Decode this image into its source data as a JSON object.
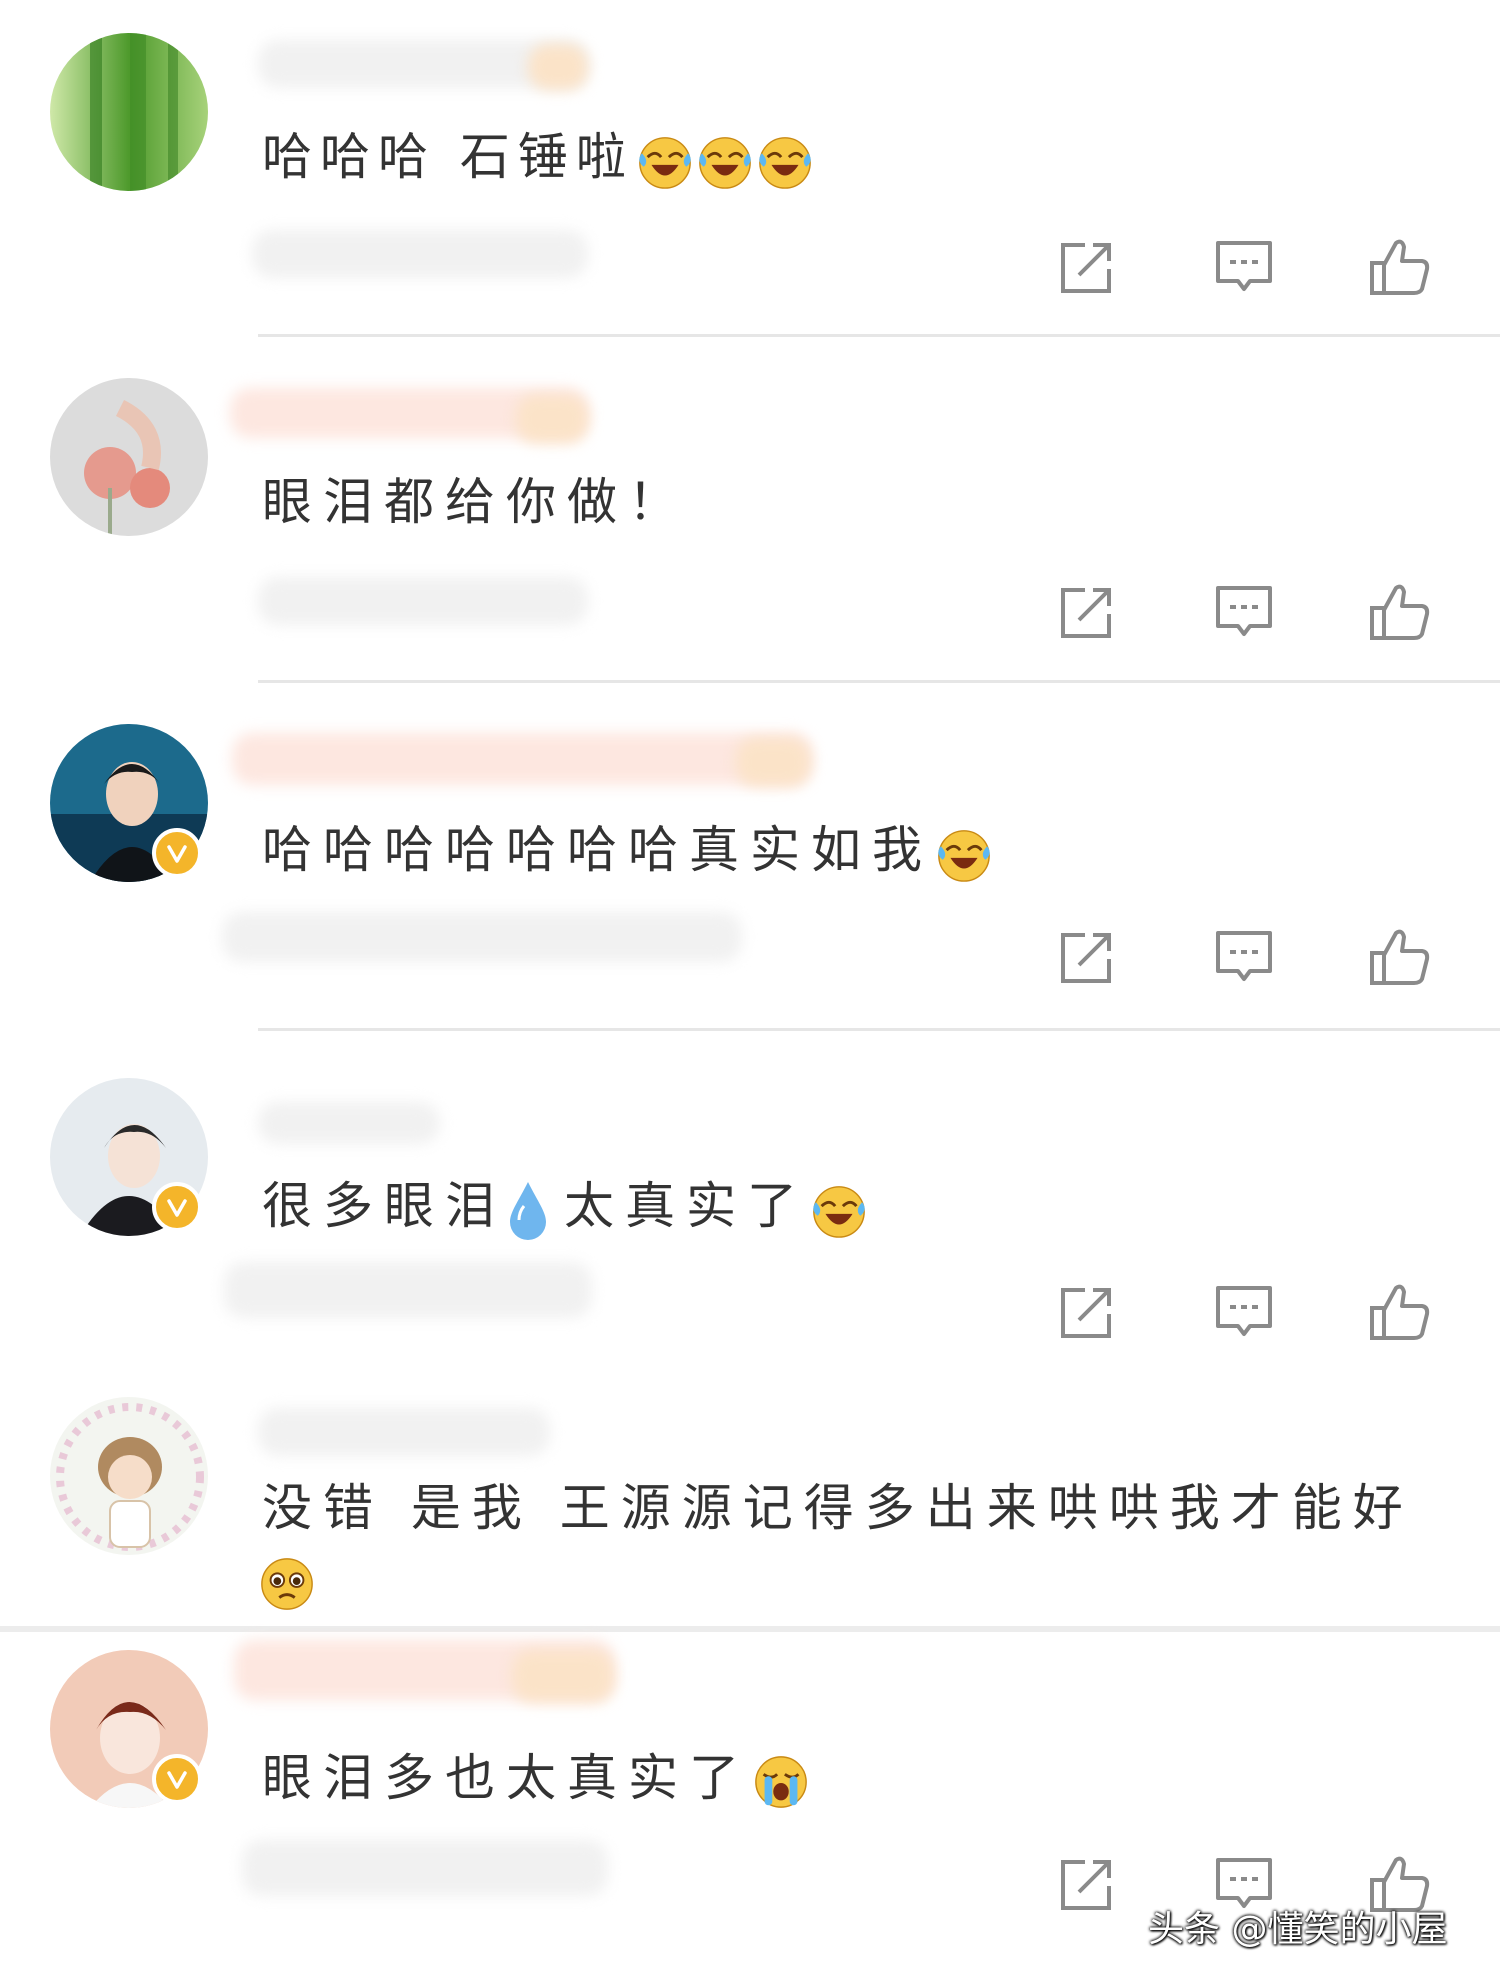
{
  "comments": [
    {
      "text": "哈哈哈  石锤啦",
      "emojis": [
        "laugh-cry",
        "laugh-cry",
        "laugh-cry"
      ],
      "verified": false
    },
    {
      "text": "眼泪都给你做！",
      "emojis": [],
      "verified": false
    },
    {
      "text": "哈哈哈哈哈哈哈真实如我",
      "emojis": [
        "laugh-cry"
      ],
      "verified": true
    },
    {
      "text_before": "很多眼泪",
      "text_after": "太真实了",
      "emojis": [
        "water-drop",
        "laugh-cry"
      ],
      "verified": true
    },
    {
      "text": "没错 是我 王源源记得多出来哄哄我才能好",
      "emojis": [
        "pleading"
      ],
      "verified": false
    },
    {
      "text": "眼泪多也太真实了",
      "emojis": [
        "loud-cry"
      ],
      "verified": true
    }
  ],
  "actions": [
    "share-icon",
    "comment-icon",
    "like-icon"
  ],
  "watermark": "头条 @懂笑的小屋",
  "colors": {
    "badge": "#f4b52a",
    "icon": "#8a8a8a",
    "divider": "#e6e6e6"
  }
}
